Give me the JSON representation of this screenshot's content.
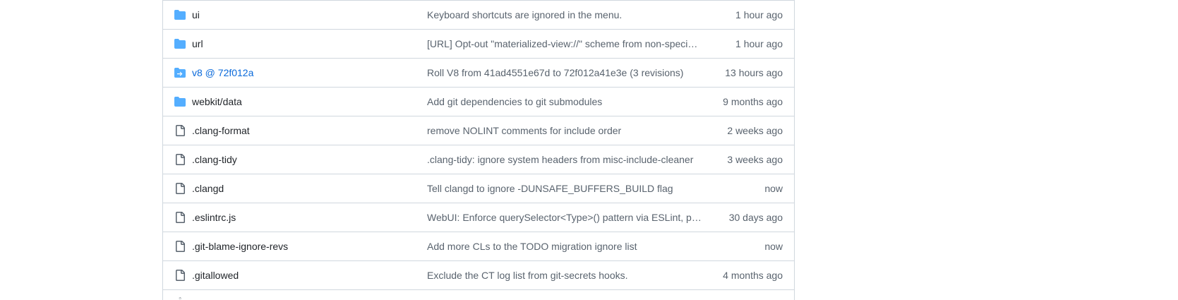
{
  "colors": {
    "folder_icon": "#54aeff",
    "file_icon": "#59636e",
    "submodule_link": "#0969da",
    "text_primary": "#1f2328",
    "text_muted": "#59636e",
    "border": "#d0d7de"
  },
  "rows": [
    {
      "name": "ui",
      "type": "folder",
      "icon": "folder-icon",
      "message": "Keyboard shortcuts are ignored in the menu.",
      "age": "1 hour ago"
    },
    {
      "name": "url",
      "type": "folder",
      "icon": "folder-icon",
      "message": "[URL] Opt-out \"materialized-view://\" scheme from non-speci…",
      "age": "1 hour ago"
    },
    {
      "name": "v8 @ 72f012a",
      "type": "submodule",
      "icon": "submodule-icon",
      "message": "Roll V8 from 41ad4551e67d to 72f012a41e3e (3 revisions)",
      "age": "13 hours ago"
    },
    {
      "name": "webkit/data",
      "type": "folder",
      "icon": "folder-icon",
      "message": "Add git dependencies to git submodules",
      "age": "9 months ago"
    },
    {
      "name": ".clang-format",
      "type": "file",
      "icon": "file-icon",
      "message": "remove NOLINT comments for include order",
      "age": "2 weeks ago"
    },
    {
      "name": ".clang-tidy",
      "type": "file",
      "icon": "file-icon",
      "message": ".clang-tidy: ignore system headers from misc-include-cleaner",
      "age": "3 weeks ago"
    },
    {
      "name": ".clangd",
      "type": "file",
      "icon": "file-icon",
      "message": "Tell clangd to ignore -DUNSAFE_BUFFERS_BUILD flag",
      "age": "now"
    },
    {
      "name": ".eslintrc.js",
      "type": "file",
      "icon": "file-icon",
      "message": "WebUI: Enforce querySelector<Type>() pattern via ESLint, pa…",
      "age": "30 days ago"
    },
    {
      "name": ".git-blame-ignore-revs",
      "type": "file",
      "icon": "file-icon",
      "message": "Add more CLs to the TODO migration ignore list",
      "age": "now"
    },
    {
      "name": ".gitallowed",
      "type": "file",
      "icon": "file-icon",
      "message": "Exclude the CT log list from git-secrets hooks.",
      "age": "4 months ago"
    }
  ]
}
